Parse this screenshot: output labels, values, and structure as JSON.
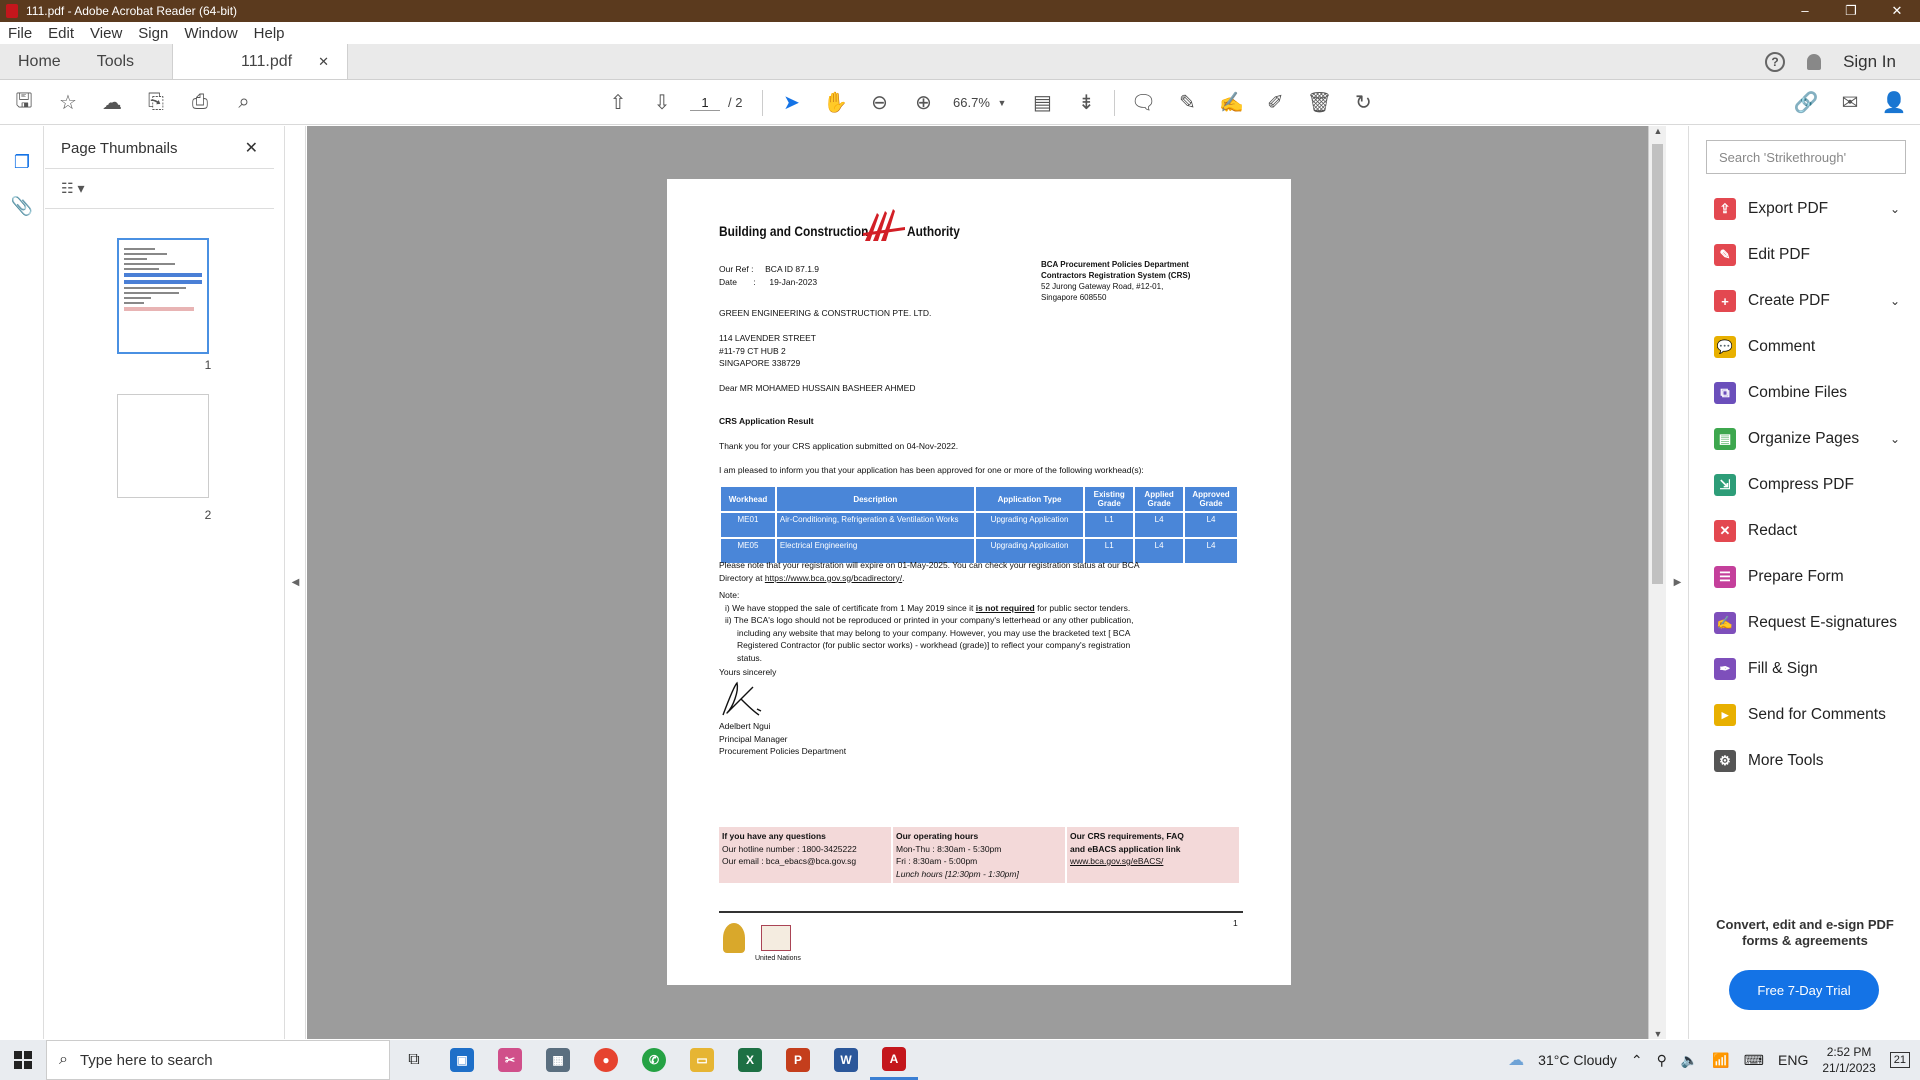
{
  "window": {
    "title": "111.pdf - Adobe Acrobat Reader (64-bit)"
  },
  "menu": [
    "File",
    "Edit",
    "View",
    "Sign",
    "Window",
    "Help"
  ],
  "tabs": {
    "home": "Home",
    "tools": "Tools",
    "document": "111.pdf",
    "signin": "Sign In"
  },
  "toolbar": {
    "current_page": "1",
    "total_pages": "/ 2",
    "zoom": "66.7%"
  },
  "thumbnails": {
    "title": "Page Thumbnails",
    "pages": [
      "1",
      "2"
    ]
  },
  "document": {
    "logo_left": "Building and Construction",
    "logo_right": "Authority",
    "ref_label": "Our Ref",
    "ref_value": "BCA ID 87.1.9",
    "date_label": "Date",
    "date_value": "19-Jan-2023",
    "dept": [
      "BCA Procurement Policies Department",
      "Contractors Registration System (CRS)",
      "52 Jurong Gateway Road, #12-01,",
      "Singapore 608550"
    ],
    "company": "GREEN ENGINEERING & CONSTRUCTION PTE. LTD.",
    "address": [
      "114 LAVENDER STREET",
      "#11-79 CT HUB 2",
      "SINGAPORE 338729"
    ],
    "salutation": "Dear MR MOHAMED HUSSAIN BASHEER AHMED",
    "subject": "CRS Application Result",
    "thanks": "Thank you for your CRS application submitted on 04-Nov-2022.",
    "pleased": "I am pleased to inform you that your application has been approved for one or more of the following workhead(s):",
    "table": {
      "headers": [
        "Workhead",
        "Description",
        "Application Type",
        "Existing Grade",
        "Applied Grade",
        "Approved Grade"
      ],
      "rows": [
        [
          "ME01",
          "Air-Conditioning, Refrigeration & Ventilation Works",
          "Upgrading Application",
          "L1",
          "L4",
          "L4"
        ],
        [
          "ME05",
          "Electrical Engineering",
          "Upgrading Application",
          "L1",
          "L4",
          "L4"
        ]
      ]
    },
    "expiry_1": "Please note that your registration will expire on 01-May-2025.  You can check your registration status at our BCA",
    "expiry_2a": "Directory at ",
    "expiry_link": "https://www.bca.gov.sg/bcadirectory/",
    "expiry_2b": ".",
    "note_label": "Note:",
    "note_1a": "i)  We have stopped the sale of certificate from 1 May 2019 since it ",
    "note_1u": "is not required",
    "note_1b": " for public sector tenders.",
    "note_2": [
      "ii) The BCA's logo should not be reproduced or printed in your company's letterhead or any other publication,",
      "including any website that may belong to your company. However, you may use the bracketed text [ BCA",
      "Registered Contractor (for public sector works) - workhead (grade)] to reflect your company's registration",
      "status."
    ],
    "closing": "Yours sincerely",
    "signer": [
      "Adelbert Ngui",
      "Principal Manager",
      "Procurement Policies Department"
    ],
    "contact": {
      "c1_title": "If you have any questions",
      "c1_l1": "Our hotline number : 1800-3425222",
      "c1_l2": "Our email : bca_ebacs@bca.gov.sg",
      "c2_title": "Our operating hours",
      "c2_l1": "Mon-Thu : 8:30am - 5:30pm",
      "c2_l2": "Fri : 8:30am - 5:00pm",
      "c2_l3": "Lunch hours [12:30pm - 1:30pm]",
      "c3_title_1": "Our CRS requirements, FAQ",
      "c3_title_2": "and eBACS application link",
      "c3_link": "www.bca.gov.sg/eBACS/"
    },
    "page_number": "1",
    "un_label": "United Nations"
  },
  "rightpanel": {
    "search_placeholder": "Search 'Strikethrough'",
    "tools": [
      {
        "label": "Export PDF",
        "color": "#e34850"
      },
      {
        "label": "Edit PDF",
        "color": "#e34850"
      },
      {
        "label": "Create PDF",
        "color": "#e34850"
      },
      {
        "label": "Comment",
        "color": "#e8b000"
      },
      {
        "label": "Combine Files",
        "color": "#6b4fbb"
      },
      {
        "label": "Organize Pages",
        "color": "#3da74e"
      },
      {
        "label": "Compress PDF",
        "color": "#2d9d78"
      },
      {
        "label": "Redact",
        "color": "#e34850"
      },
      {
        "label": "Prepare Form",
        "color": "#c43f9b"
      },
      {
        "label": "Request E-signatures",
        "color": "#7e4fbb"
      },
      {
        "label": "Fill & Sign",
        "color": "#7e4fbb"
      },
      {
        "label": "Send for Comments",
        "color": "#e8b000"
      },
      {
        "label": "More Tools",
        "color": "#555555"
      }
    ],
    "promo": [
      "Convert, edit and e-sign PDF",
      "forms & agreements"
    ],
    "trial": "Free 7-Day Trial"
  },
  "taskbar": {
    "search_placeholder": "Type here to search",
    "weather": "31°C  Cloudy",
    "lang": "ENG",
    "time": "2:52 PM",
    "date": "21/1/2023",
    "notif_count": "21"
  }
}
